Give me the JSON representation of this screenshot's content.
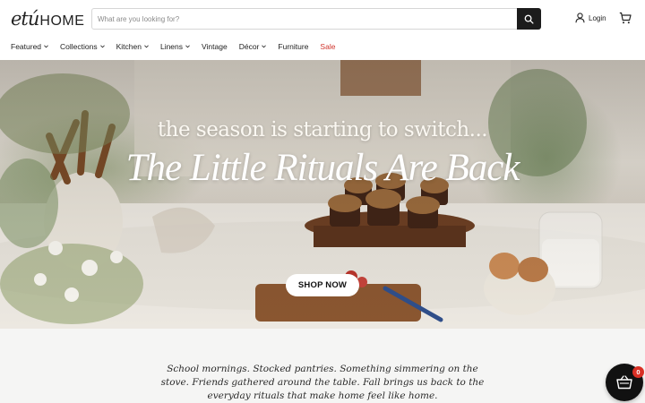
{
  "header": {
    "logo_script": "etú",
    "logo_word": "HOME",
    "search_placeholder": "What are you looking for?",
    "login_label": "Login",
    "search_icon": "search-icon",
    "user_icon": "user-icon",
    "cart_icon": "cart-icon"
  },
  "nav": {
    "items": [
      {
        "label": "Featured",
        "dropdown": true
      },
      {
        "label": "Collections",
        "dropdown": true
      },
      {
        "label": "Kitchen",
        "dropdown": true
      },
      {
        "label": "Linens",
        "dropdown": true
      },
      {
        "label": "Vintage",
        "dropdown": false
      },
      {
        "label": "Décor",
        "dropdown": true
      },
      {
        "label": "Furniture",
        "dropdown": false
      },
      {
        "label": "Sale",
        "dropdown": false
      }
    ],
    "sale_color": "#d0342c"
  },
  "hero": {
    "line1": "the season is starting to switch...",
    "line2": "The Little Rituals Are Back",
    "cta": "SHOP NOW"
  },
  "intro": {
    "text": "School mornings. Stocked pantries. Something simmering on the stove. Friends gathered around the table. Fall brings us back to the everyday rituals that make home feel like home."
  },
  "cart_widget": {
    "count": "0",
    "icon": "basket-icon"
  }
}
